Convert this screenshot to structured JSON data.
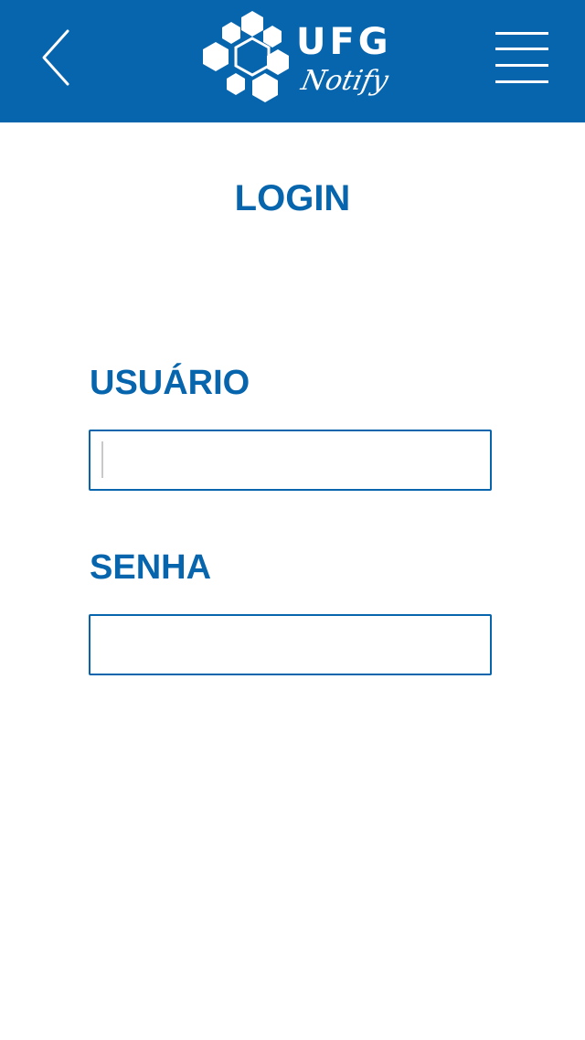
{
  "app": {
    "brand_name": "UFG",
    "brand_tagline": "Notify",
    "accent_color": "#0765ad"
  },
  "header": {
    "back_icon": "chevron-left-icon",
    "menu_icon": "hamburger-menu-icon"
  },
  "page": {
    "title": "LOGIN"
  },
  "form": {
    "username_label": "USUÁRIO",
    "username_value": "",
    "password_label": "SENHA",
    "password_value": ""
  }
}
